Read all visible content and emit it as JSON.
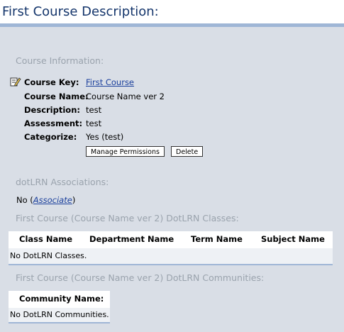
{
  "header": {
    "title": "First Course Description:"
  },
  "course_info": {
    "heading": "Course Information:",
    "fields": {
      "key_label": "Course Key:",
      "key_value": "First Course",
      "name_label": "Course Name:",
      "name_value": "Course Name ver 2",
      "description_label": "Description:",
      "description_value": "test",
      "assessment_label": "Assessment:",
      "assessment_value": "test",
      "categorize_label": "Categorize:",
      "categorize_value": "Yes (test)"
    },
    "buttons": {
      "manage_permissions": "Manage Permissions",
      "delete": "Delete"
    }
  },
  "associations": {
    "heading": "dotLRN Associations:",
    "status_prefix": "No (",
    "associate_link": "Associate",
    "status_suffix": ")"
  },
  "classes": {
    "heading": "First Course (Course Name ver 2) DotLRN Classes:",
    "columns": [
      "Class Name",
      "Department Name",
      "Term Name",
      "Subject Name"
    ],
    "empty": "No DotLRN Classes."
  },
  "communities": {
    "heading": "First Course (Course Name ver 2) DotLRN Communities:",
    "columns": [
      "Community Name:"
    ],
    "empty": "No DotLRN Communities."
  },
  "colors": {
    "title": "#14356b",
    "rule": "#9fb6d6",
    "panel": "#d9dee6",
    "section_heading": "#9aa3ad",
    "link": "#1a3f9c"
  },
  "icons": {
    "edit": "edit-pencil-icon"
  }
}
